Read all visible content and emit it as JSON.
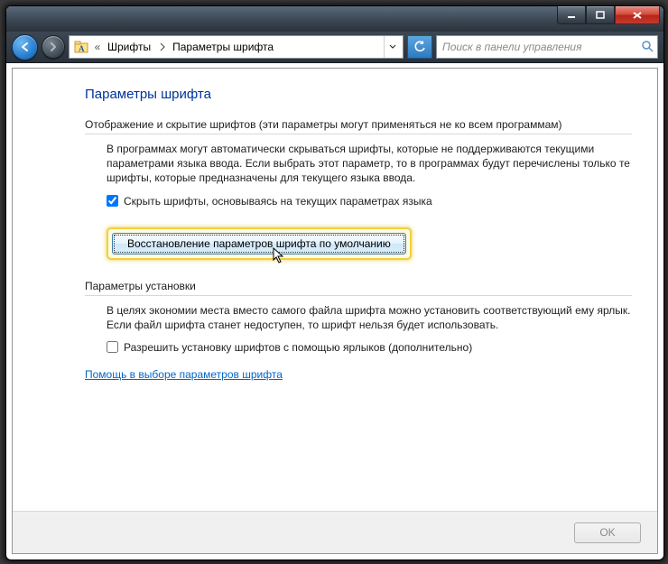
{
  "window_controls": {
    "minimize": "minimize",
    "maximize": "maximize",
    "close": "close"
  },
  "breadcrumb": {
    "seg1": "Шрифты",
    "seg2": "Параметры шрифта"
  },
  "search": {
    "placeholder": "Поиск в панели управления"
  },
  "page": {
    "title": "Параметры шрифта",
    "section1": {
      "header": "Отображение и скрытие шрифтов (эти параметры могут применяться не ко всем программам)",
      "body": "В программах могут автоматически скрываться шрифты, которые не поддерживаются текущими параметрами языка ввода. Если выбрать этот параметр, то в программах будут перечислены только те шрифты, которые предназначены для текущего языка ввода.",
      "checkbox_label": "Скрыть шрифты, основываясь на текущих параметрах языка",
      "checkbox_checked": true,
      "restore_button": "Восстановление параметров шрифта по умолчанию"
    },
    "section2": {
      "header": "Параметры установки",
      "body": "В целях экономии места вместо самого файла шрифта можно установить соответствующий ему ярлык. Если файл шрифта станет недоступен, то шрифт нельзя будет использовать.",
      "checkbox_label": "Разрешить установку шрифтов с помощью ярлыков (дополнительно)",
      "checkbox_checked": false
    },
    "help_link": "Помощь в выборе параметров шрифта",
    "ok_button": "OK"
  }
}
